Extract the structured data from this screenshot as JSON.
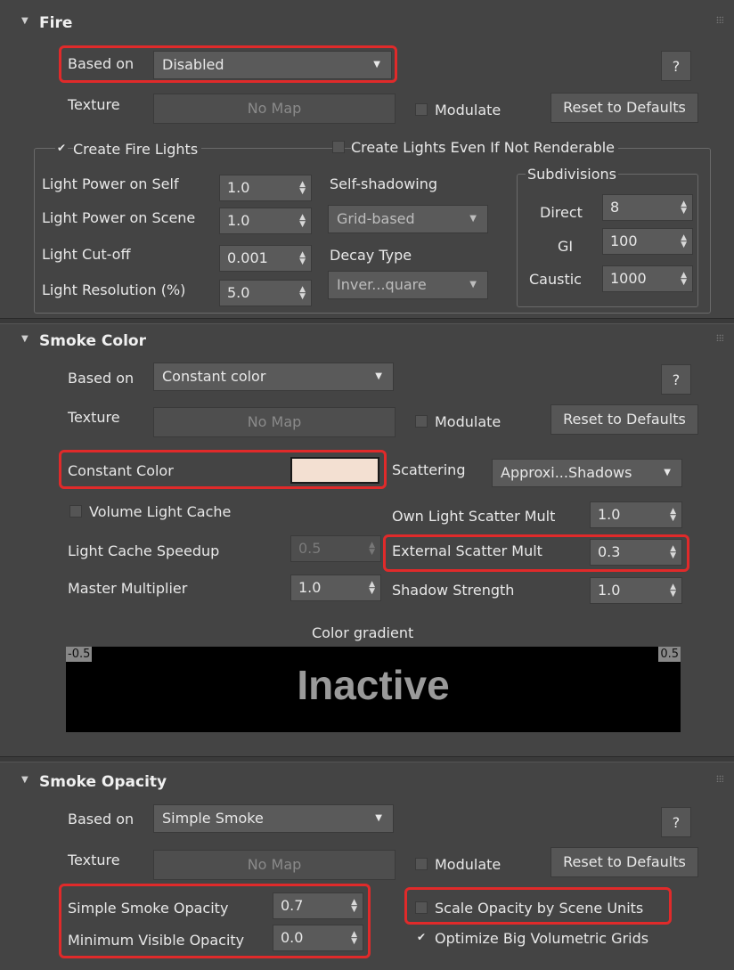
{
  "fire": {
    "title": "Fire",
    "based_on_label": "Based on",
    "based_on_value": "Disabled",
    "help": "?",
    "texture_label": "Texture",
    "texture_map": "No Map",
    "modulate_label": "Modulate",
    "reset_label": "Reset to Defaults",
    "create_fire_lights_label": "Create Fire Lights",
    "create_lights_even_label": "Create Lights Even If Not Renderable",
    "light_power_self_label": "Light Power on Self",
    "light_power_self_value": "1.0",
    "light_power_scene_label": "Light Power on Scene",
    "light_power_scene_value": "1.0",
    "light_cutoff_label": "Light Cut-off",
    "light_cutoff_value": "0.001",
    "light_resolution_label": "Light Resolution (%)",
    "light_resolution_value": "5.0",
    "self_shadowing_label": "Self-shadowing",
    "self_shadowing_value": "Grid-based",
    "decay_type_label": "Decay Type",
    "decay_type_value": "Inver...quare",
    "subdivisions_label": "Subdivisions",
    "direct_label": "Direct",
    "direct_value": "8",
    "gi_label": "GI",
    "gi_value": "100",
    "caustic_label": "Caustic",
    "caustic_value": "1000"
  },
  "smoke_color": {
    "title": "Smoke Color",
    "based_on_label": "Based on",
    "based_on_value": "Constant color",
    "help": "?",
    "texture_label": "Texture",
    "texture_map": "No Map",
    "modulate_label": "Modulate",
    "reset_label": "Reset to Defaults",
    "constant_color_label": "Constant Color",
    "constant_color_swatch": "#f3e0d2",
    "scattering_label": "Scattering",
    "scattering_value": "Approxi...Shadows",
    "volume_light_cache_label": "Volume Light Cache",
    "own_light_scatter_label": "Own Light Scatter Mult",
    "own_light_scatter_value": "1.0",
    "light_cache_speedup_label": "Light Cache Speedup",
    "light_cache_speedup_value": "0.5",
    "external_scatter_label": "External Scatter Mult",
    "external_scatter_value": "0.3",
    "master_multiplier_label": "Master Multiplier",
    "master_multiplier_value": "1.0",
    "shadow_strength_label": "Shadow Strength",
    "shadow_strength_value": "1.0",
    "gradient_title": "Color gradient",
    "gradient_min": "-0.5",
    "gradient_max": "0.5",
    "gradient_status": "Inactive"
  },
  "smoke_opacity": {
    "title": "Smoke Opacity",
    "based_on_label": "Based on",
    "based_on_value": "Simple Smoke",
    "help": "?",
    "texture_label": "Texture",
    "texture_map": "No Map",
    "modulate_label": "Modulate",
    "reset_label": "Reset to Defaults",
    "simple_smoke_opacity_label": "Simple Smoke Opacity",
    "simple_smoke_opacity_value": "0.7",
    "minimum_visible_opacity_label": "Minimum Visible Opacity",
    "minimum_visible_opacity_value": "0.0",
    "scale_opacity_label": "Scale Opacity by Scene Units",
    "optimize_label": "Optimize Big Volumetric Grids"
  },
  "glyphs": {
    "collapse_arrow": "▼",
    "dropdown_arrow": "▼",
    "spinner_arrows": "▲▼",
    "check": "✔"
  }
}
